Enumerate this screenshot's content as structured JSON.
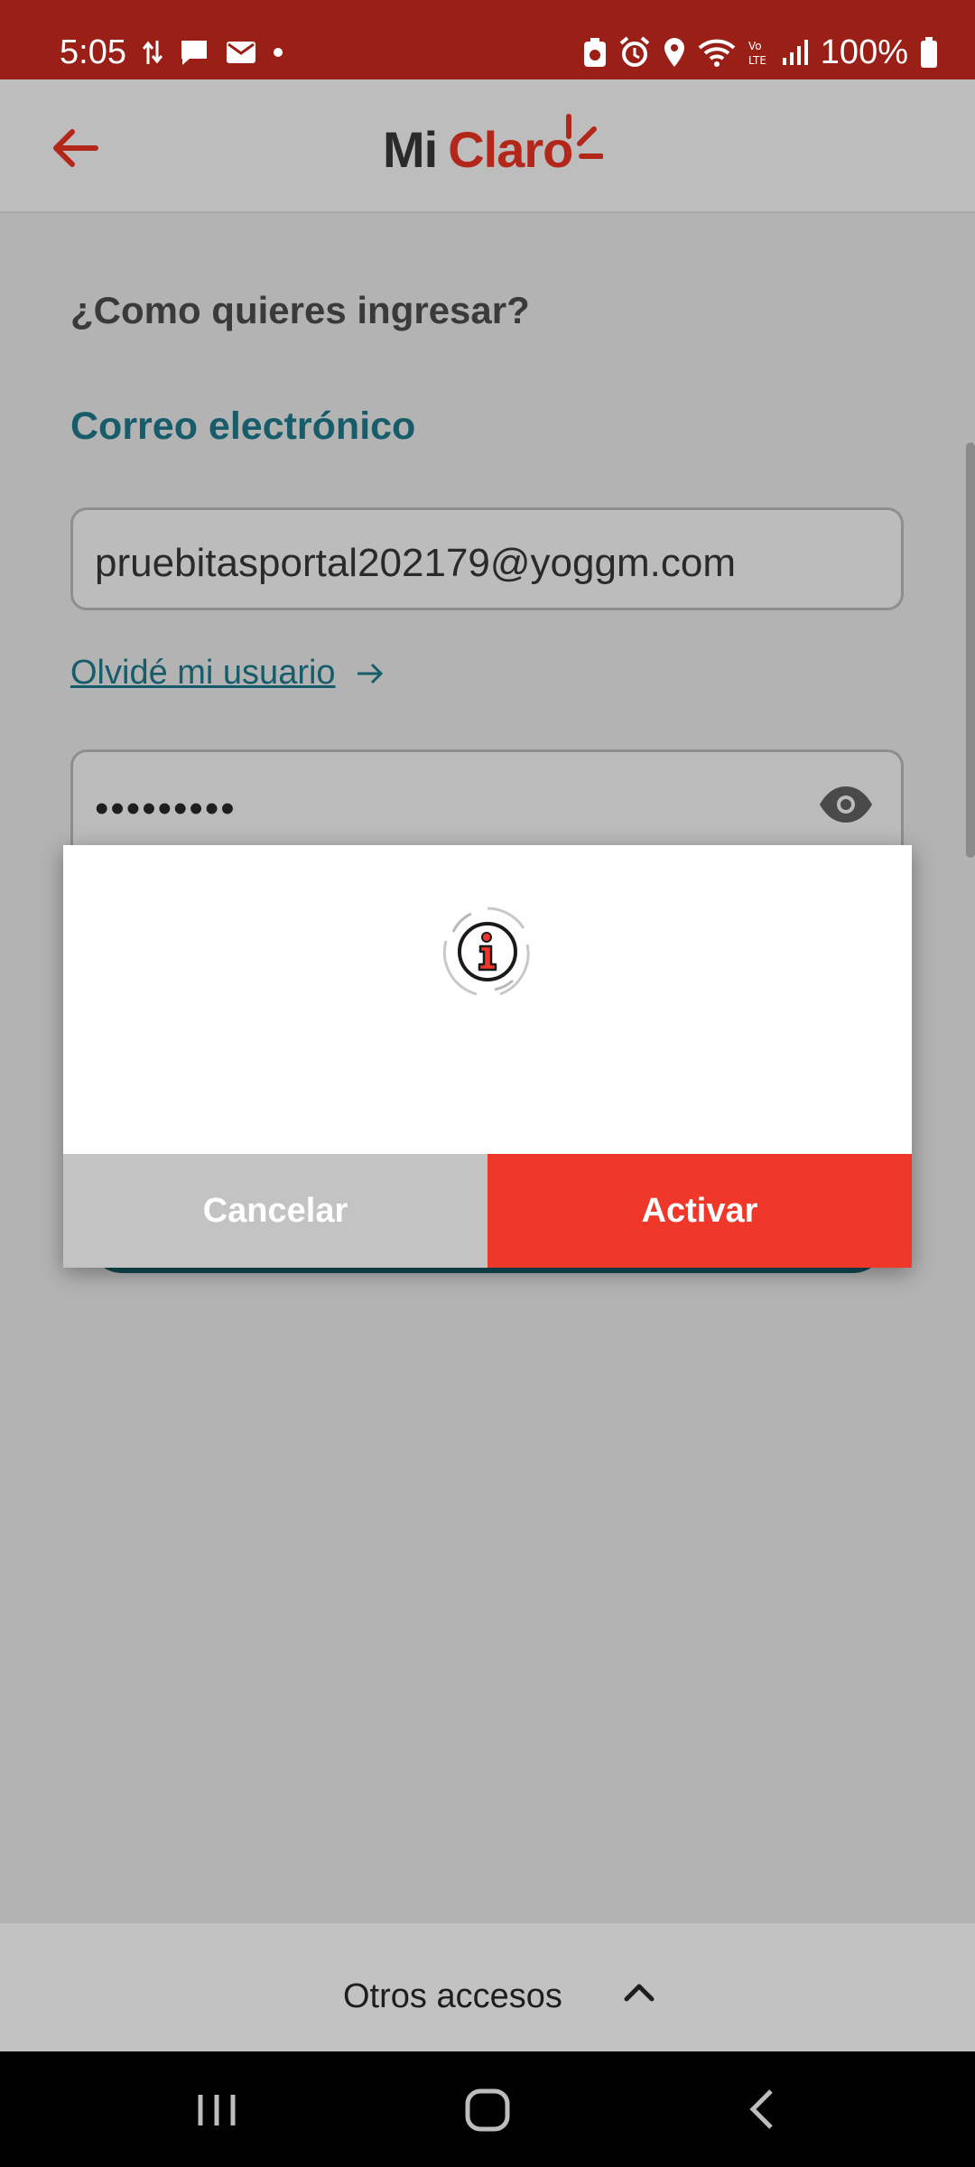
{
  "status_bar": {
    "time": "5:05",
    "battery": "100%"
  },
  "header": {
    "logo_mi": "Mi",
    "logo_claro": "Claro"
  },
  "login": {
    "question": "¿Como quieres ingresar?",
    "method_title": "Correo electrónico",
    "email_value": "pruebitasportal202179@yoggm.com",
    "forgot_user": "Olvidé mi usuario",
    "password_mask": "•••••••••"
  },
  "dialog": {
    "icon": "info-icon",
    "cancel_label": "Cancelar",
    "activate_label": "Activar"
  },
  "bottom": {
    "other_access": "Otros accesos"
  },
  "colors": {
    "status_bar": "#9a1f17",
    "brand_red": "#b3271b",
    "accent_red": "#ef3829",
    "teal": "#175c6a"
  }
}
